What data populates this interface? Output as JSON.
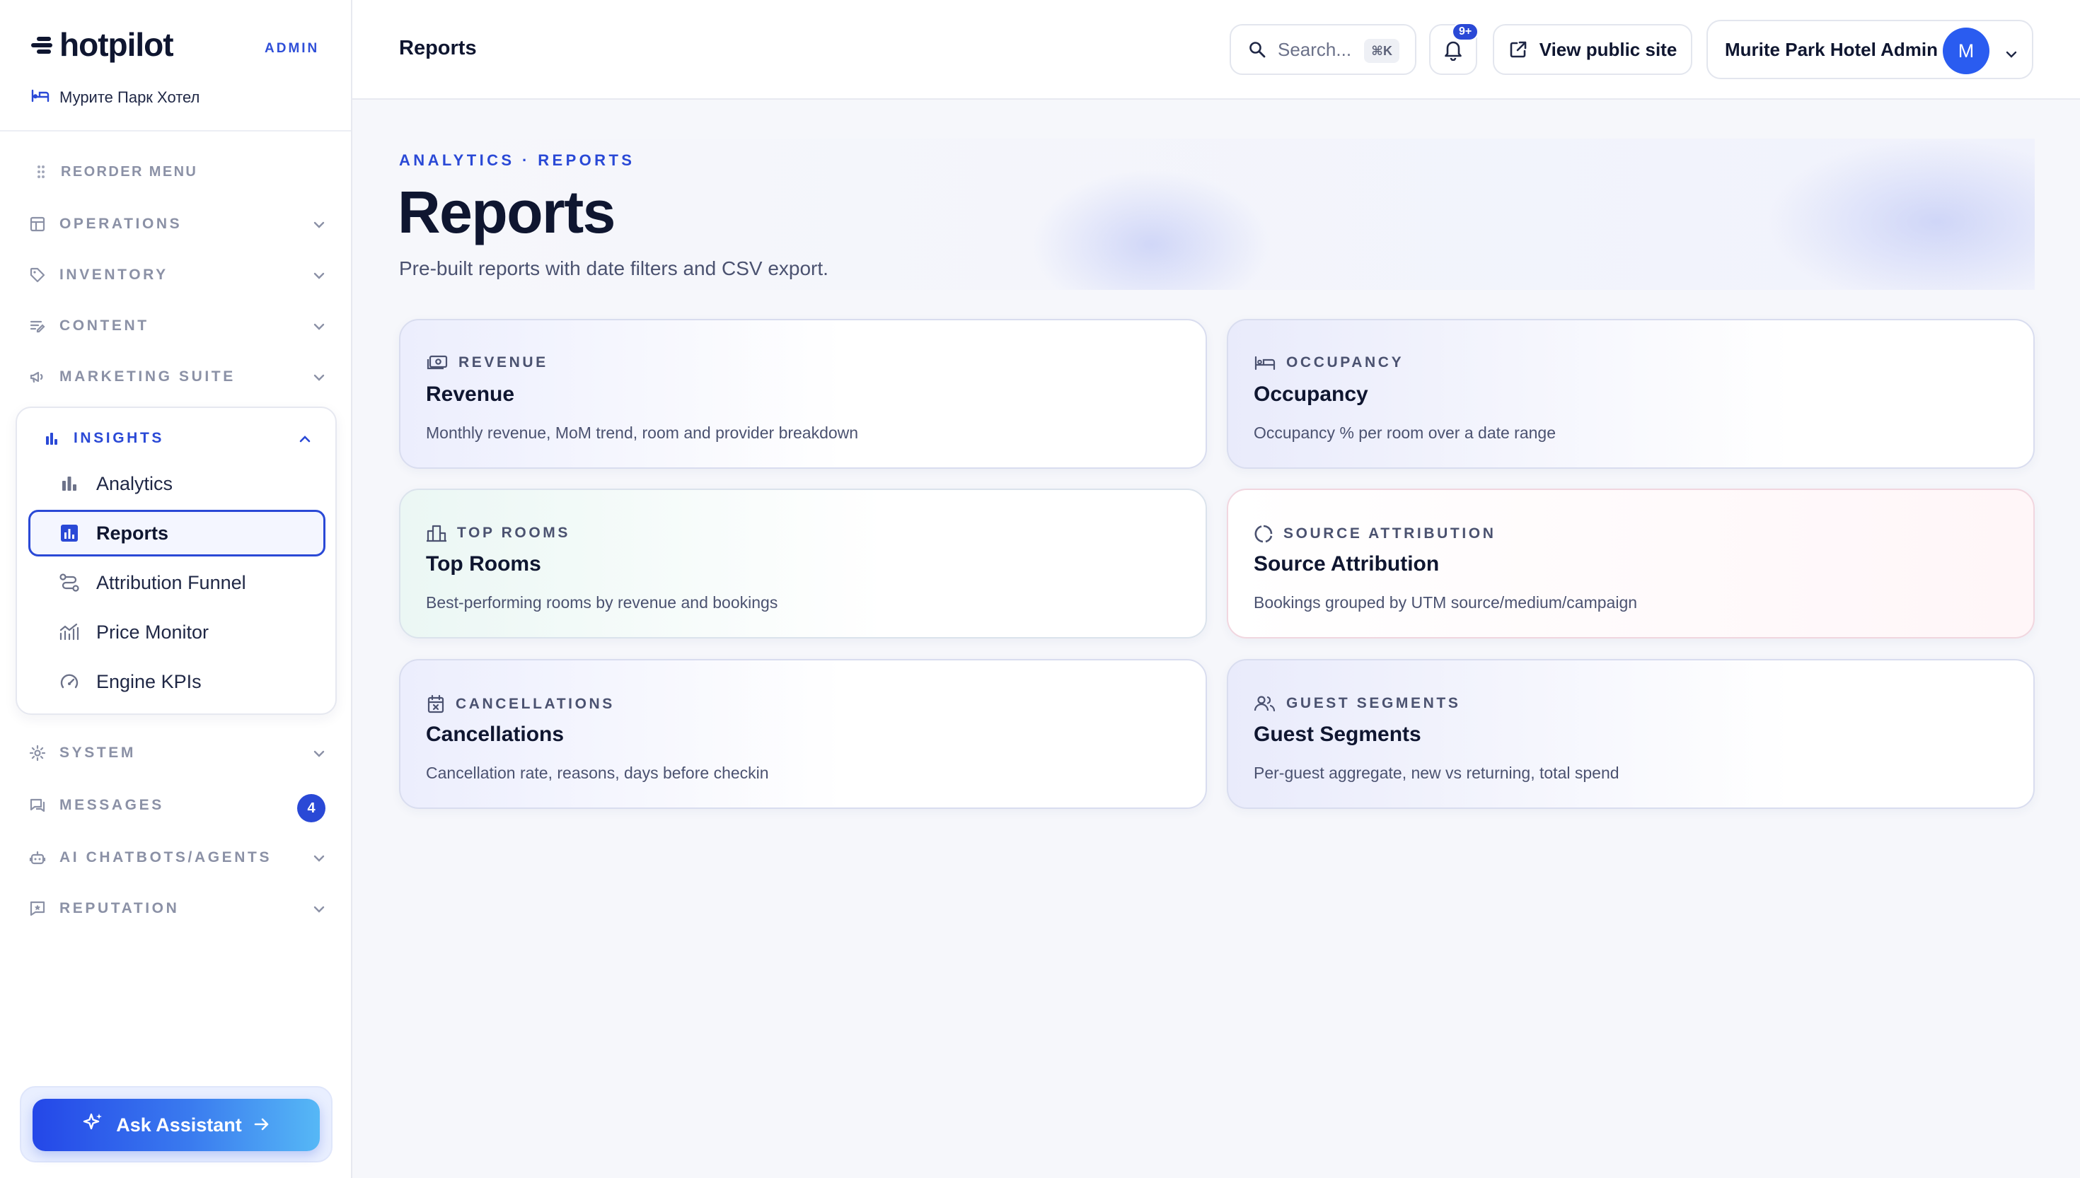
{
  "brand": {
    "name": "hotpilot",
    "tag": "ADMIN",
    "hotel": "Мурите Парк Хотел"
  },
  "sidebar": {
    "reorder_label": "REORDER MENU",
    "groups": [
      {
        "label": "OPERATIONS",
        "icon": "layout-icon"
      },
      {
        "label": "INVENTORY",
        "icon": "tag-icon"
      },
      {
        "label": "CONTENT",
        "icon": "edit-lines-icon"
      },
      {
        "label": "MARKETING SUITE",
        "icon": "megaphone-icon"
      }
    ],
    "insights": {
      "label": "INSIGHTS",
      "items": [
        {
          "label": "Analytics",
          "icon": "bar-chart-icon"
        },
        {
          "label": "Reports",
          "icon": "report-chart-icon"
        },
        {
          "label": "Attribution Funnel",
          "icon": "route-icon"
        },
        {
          "label": "Price Monitor",
          "icon": "trend-chart-icon"
        },
        {
          "label": "Engine KPIs",
          "icon": "gauge-icon"
        }
      ]
    },
    "lower_groups": [
      {
        "label": "SYSTEM",
        "icon": "gear-icon"
      },
      {
        "label": "MESSAGES",
        "icon": "chat-icon",
        "badge": "4"
      },
      {
        "label": "AI CHATBOTS/AGENTS",
        "icon": "robot-icon"
      },
      {
        "label": "REPUTATION",
        "icon": "review-icon"
      }
    ],
    "assistant_label": "Ask Assistant"
  },
  "topbar": {
    "title": "Reports",
    "search_placeholder": "Search...",
    "search_shortcut": "⌘K",
    "notifications_badge": "9+",
    "public_site_label": "View public site",
    "account_name": "Murite Park Hotel Admin",
    "avatar_initial": "M"
  },
  "page": {
    "eyebrow": "ANALYTICS · REPORTS",
    "title": "Reports",
    "subtitle": "Pre-built reports with date filters and CSV export."
  },
  "cards": [
    {
      "kicker": "REVENUE",
      "title": "Revenue",
      "desc": "Monthly revenue, MoM trend, room and provider breakdown",
      "icon": "cash-icon"
    },
    {
      "kicker": "OCCUPANCY",
      "title": "Occupancy",
      "desc": "Occupancy % per room over a date range",
      "icon": "bed-icon"
    },
    {
      "kicker": "TOP ROOMS",
      "title": "Top Rooms",
      "desc": "Best-performing rooms by revenue and bookings",
      "icon": "building-icon"
    },
    {
      "kicker": "SOURCE ATTRIBUTION",
      "title": "Source Attribution",
      "desc": "Bookings grouped by UTM source/medium/campaign",
      "icon": "donut-icon"
    },
    {
      "kicker": "CANCELLATIONS",
      "title": "Cancellations",
      "desc": "Cancellation rate, reasons, days before checkin",
      "icon": "calendar-x-icon"
    },
    {
      "kicker": "GUEST SEGMENTS",
      "title": "Guest Segments",
      "desc": "Per-guest aggregate, new vs returning, total spend",
      "icon": "users-icon"
    }
  ],
  "colors": {
    "accent": "#2a49d6",
    "text": "#0f1630",
    "muted": "#8b91a6"
  }
}
